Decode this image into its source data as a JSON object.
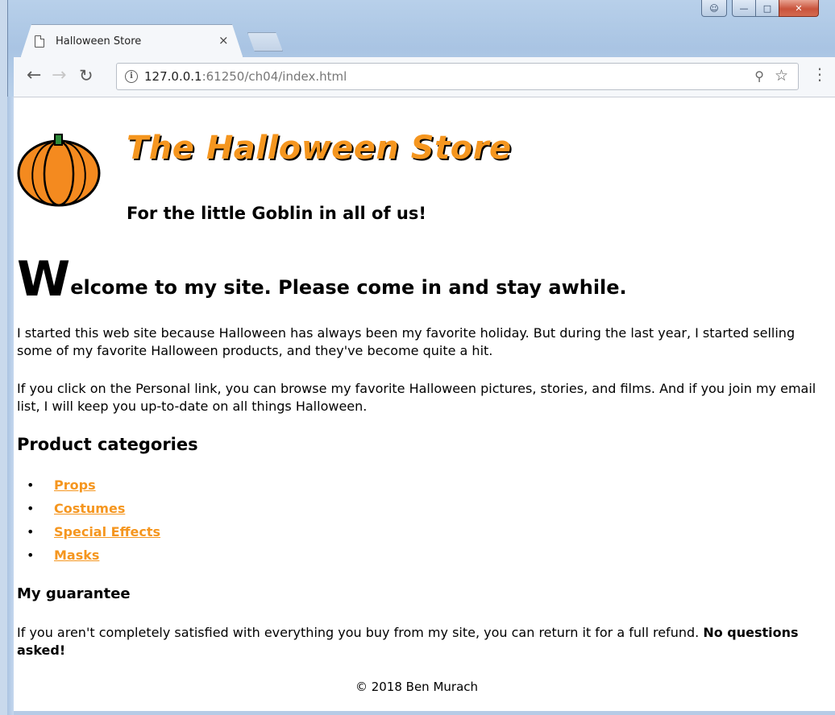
{
  "browser": {
    "tab_title": "Halloween Store",
    "tab_close": "×",
    "url_host": "127.0.0.1",
    "url_rest": ":61250/ch04/index.html",
    "icons": {
      "back": "back-arrow-icon",
      "forward": "forward-arrow-icon",
      "reload": "reload-icon",
      "info": "info-icon",
      "zoom": "zoom-icon",
      "bookmark": "star-icon",
      "menu": "kebab-menu-icon"
    }
  },
  "page": {
    "title": "The Halloween Store",
    "tagline": "For the little Goblin in all of us!",
    "welcome_dropcap": "W",
    "welcome_rest": "elcome to my site. Please come in and stay awhile.",
    "intro_paragraph": "I started this web site because Halloween has always been my favorite holiday. But during the last year, I started selling some of my favorite Halloween products, and they've become quite a hit.",
    "personal_paragraph": "If you click on the Personal link, you can browse my favorite Halloween pictures, stories, and films. And if you join my email list, I will keep you up-to-date on all things Halloween.",
    "categories_heading": "Product categories",
    "categories": [
      {
        "label": "Props"
      },
      {
        "label": "Costumes"
      },
      {
        "label": "Special Effects"
      },
      {
        "label": "Masks"
      }
    ],
    "guarantee_heading": "My guarantee",
    "guarantee_text": "If you aren't completely satisfied with everything you buy from my site, you can return it for a full refund.",
    "guarantee_emphasis": "No questions asked!",
    "footer": "© 2018 Ben Murach",
    "colors": {
      "title_orange": "#f5961f",
      "link_orange": "#f5961f"
    }
  }
}
